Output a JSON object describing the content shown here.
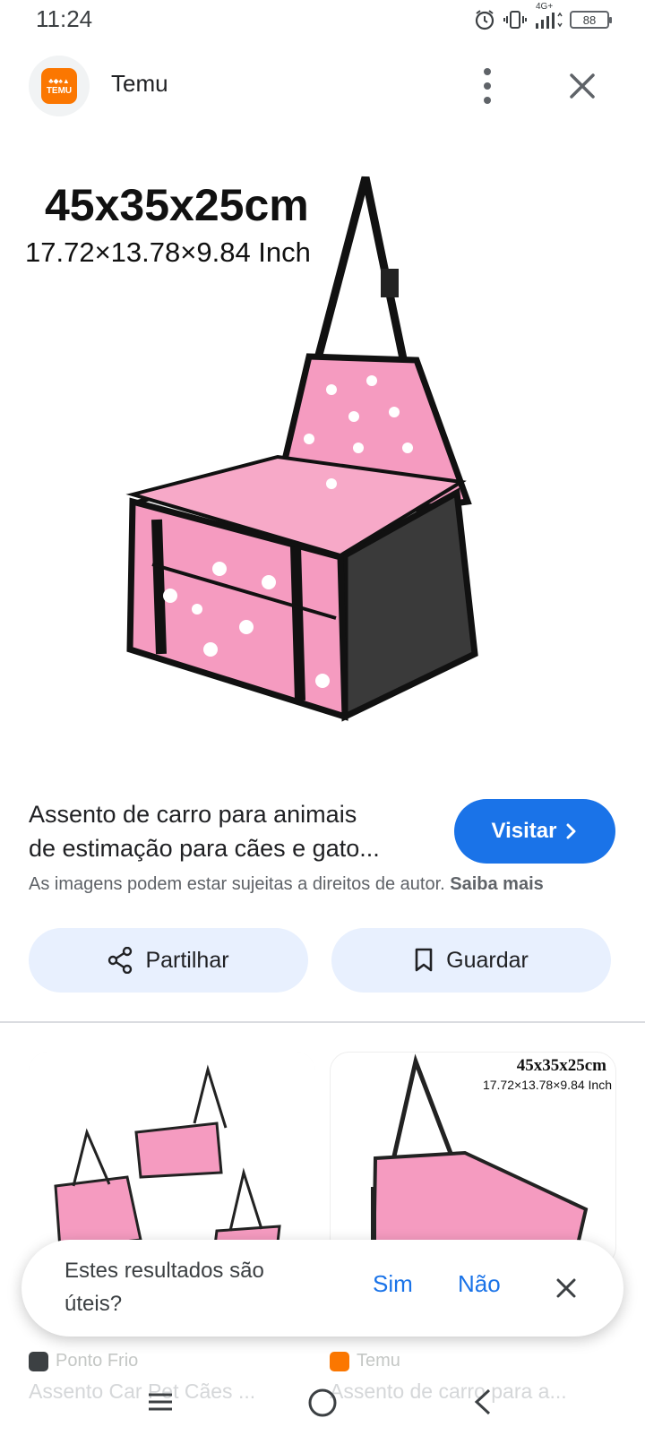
{
  "status": {
    "time": "11:24",
    "network": "4G+",
    "battery": "88"
  },
  "header": {
    "site": "Temu",
    "logo_text": "TEMU",
    "menu_icon": "more-vert-icon",
    "close_icon": "close-icon"
  },
  "product_image": {
    "dimension_cm": "45x35x25cm",
    "dimension_inch": "17.72×13.78×9.84 Inch"
  },
  "result": {
    "title_line1": "Assento de carro para animais",
    "title_line2": "de estimação para cães e gato...",
    "visit_label": "Visitar",
    "copyright": "As imagens podem estar sujeitas a direitos de autor.",
    "learn_more": "Saiba mais"
  },
  "actions": {
    "share_label": "Partilhar",
    "save_label": "Guardar"
  },
  "related": [
    {
      "source": "Ponto Frio",
      "caption": "Assento Car Pet Cães ...",
      "color": "#3c4043"
    },
    {
      "source": "Temu",
      "caption": "Assento de carro para a...",
      "color": "#fb7701",
      "dimension_cm": "45x35x25cm",
      "dimension_inch": "17.72×13.78×9.84 Inch"
    }
  ],
  "feedback": {
    "question": "Estes resultados são úteis?",
    "yes": "Sim",
    "no": "Não"
  },
  "colors": {
    "accent": "#1a73e8",
    "chip_bg": "#e8f0fe",
    "product_pink": "#f59bc0",
    "temu_orange": "#fb7701"
  }
}
